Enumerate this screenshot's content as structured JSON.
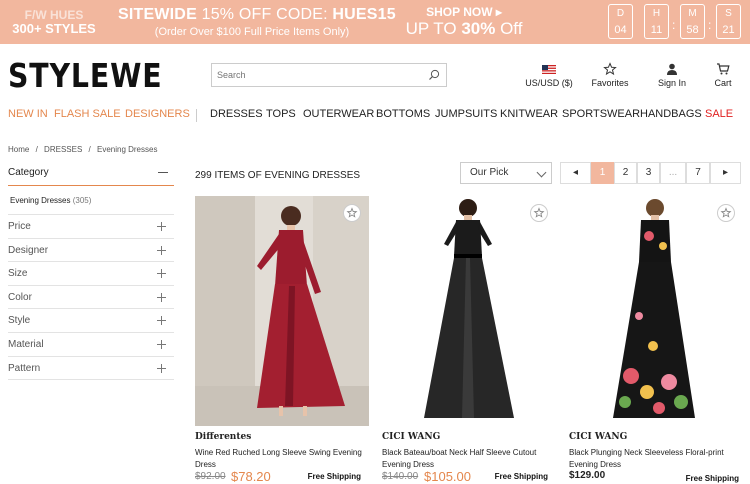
{
  "banner": {
    "fw_prefix": "F/W ",
    "fw_hues": "HUES",
    "styles": "300+ STYLES",
    "sitewide_prefix": "SITEWIDE ",
    "sitewide_off": "15% OFF CODE: ",
    "code": "HUES15",
    "order_note": "(Order Over $100 Full Price Items Only)",
    "shop_now": "SHOP NOW ▸",
    "up_to": "UP TO ",
    "up_to_pct": "30%",
    "up_to_off": " Off",
    "countdown": [
      {
        "label": "D",
        "value": "04"
      },
      {
        "label": "H",
        "value": "11"
      },
      {
        "label": "M",
        "value": "58"
      },
      {
        "label": "S",
        "value": "21"
      }
    ],
    "sep": ":",
    "bg_color": "#f2b79e"
  },
  "header": {
    "logo": "STYLEWE",
    "search_placeholder": "Search",
    "currency": "US/USD ($)",
    "favorites": "Favorites",
    "sign_in": "Sign In",
    "cart": "Cart"
  },
  "nav": {
    "new_in": "NEW IN",
    "flash_sale": "FLASH SALE",
    "designers": "DESIGNERS",
    "items": [
      "DRESSES",
      "TOPS",
      "OUTERWEAR",
      "BOTTOMS",
      "JUMPSUITS",
      "KNITWEAR",
      "SPORTSWEAR",
      "HANDBAGS",
      "SALE"
    ],
    "accent_color": "#e4874d",
    "sale_color": "#e02020"
  },
  "breadcrumb": [
    "Home",
    "/",
    "DRESSES",
    "/",
    "Evening Dresses"
  ],
  "sidebar": {
    "category_title": "Category",
    "category_item": "Evening Dresses",
    "category_count": "(305)",
    "filters": [
      "Price",
      "Designer",
      "Size",
      "Color",
      "Style",
      "Material",
      "Pattern"
    ]
  },
  "listing": {
    "count_text": "299 ITEMS OF EVENING DRESSES",
    "sort_value": "Our Pick",
    "pager": {
      "prev": "◂",
      "pages": [
        "1",
        "2",
        "3",
        "...",
        "7"
      ],
      "next": "▸",
      "active": "1"
    }
  },
  "products": [
    {
      "brand": "Differentes",
      "name": "Wine Red Ruched Long Sleeve Swing Evening Dress",
      "old_price": "$92.00",
      "new_price": "$78.20",
      "shipping": "Free Shipping"
    },
    {
      "brand": "CICI WANG",
      "name": "Black Bateau/boat Neck Half Sleeve Cutout Evening Dress",
      "old_price": "$140.00",
      "new_price": "$105.00",
      "shipping": "Free Shipping"
    },
    {
      "brand": "CICI WANG",
      "name": "Black Plunging Neck Sleeveless Floral-print Evening Dress",
      "price": "$129.00",
      "shipping": "Free Shipping"
    }
  ]
}
